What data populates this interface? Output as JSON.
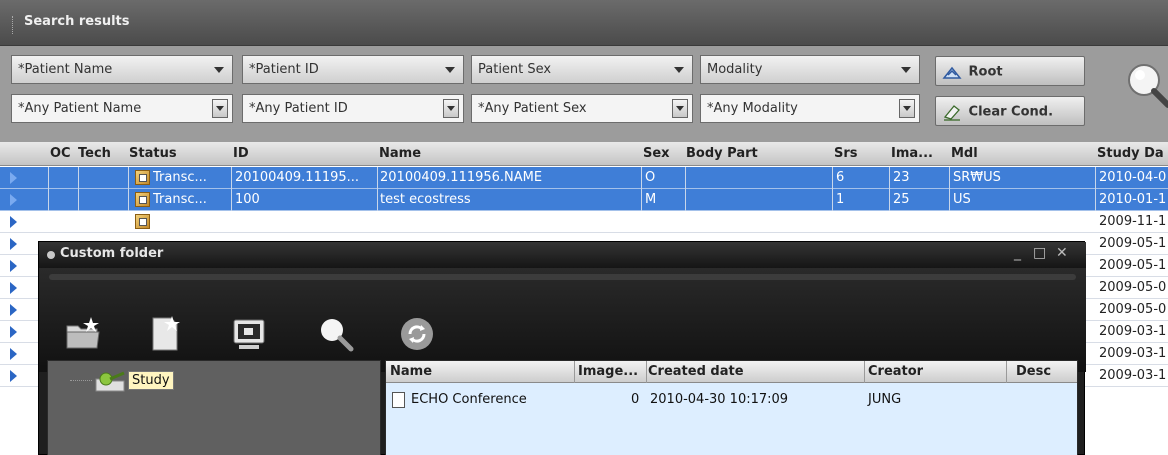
{
  "panel": {
    "title": "Search results"
  },
  "filters": {
    "row1": [
      "*Patient Name",
      "*Patient ID",
      "Patient Sex",
      "Modality"
    ],
    "row2": [
      "*Any Patient Name",
      "*Any Patient ID",
      "*Any Patient Sex",
      "*Any Modality"
    ],
    "root_button": "Root",
    "clear_button": "Clear Cond."
  },
  "grid": {
    "columns": [
      "OC",
      "Tech",
      "Status",
      "ID",
      "Name",
      "Sex",
      "Body Part",
      "Srs",
      "Ima...",
      "Mdl",
      "Study Da"
    ],
    "rows": [
      {
        "selected": true,
        "status": "Transc...",
        "id": "20100409.11195...",
        "name": "20100409.111956.NAME",
        "sex": "O",
        "srs": "6",
        "ima": "23",
        "mdl": "SR₩US",
        "date": "2010-04-0"
      },
      {
        "selected": true,
        "status": "Transc...",
        "id": "100",
        "name": "test ecostress",
        "sex": "M",
        "srs": "1",
        "ima": "25",
        "mdl": "US",
        "date": "2010-01-1"
      },
      {
        "selected": false,
        "status": "",
        "id": "",
        "name": "",
        "sex": "",
        "srs": "",
        "ima": "",
        "mdl": "",
        "date": "2009-11-1"
      },
      {
        "selected": false,
        "date": "2009-05-1"
      },
      {
        "selected": false,
        "date": "2009-05-1"
      },
      {
        "selected": false,
        "date": "2009-05-0"
      },
      {
        "selected": false,
        "date": "2009-05-0"
      },
      {
        "selected": false,
        "date": "2009-03-1"
      },
      {
        "selected": false,
        "date": "2009-03-1"
      },
      {
        "selected": false,
        "date": "2009-03-1"
      }
    ]
  },
  "custom_folder": {
    "title": "Custom folder",
    "window_controls": [
      "_",
      "□",
      "✕"
    ],
    "toolbar_icons": [
      "new-folder-icon",
      "new-document-icon",
      "monitor-icon",
      "search-icon",
      "refresh-icon"
    ],
    "tree": {
      "root_label": "Study"
    },
    "list": {
      "columns": [
        "Name",
        "Image...",
        "Created date",
        "Creator",
        "Desc"
      ],
      "rows": [
        {
          "name": "ECHO Conference",
          "images": "0",
          "created": "2010-04-30 10:17:09",
          "creator": "JUNG",
          "desc": ""
        }
      ]
    }
  }
}
